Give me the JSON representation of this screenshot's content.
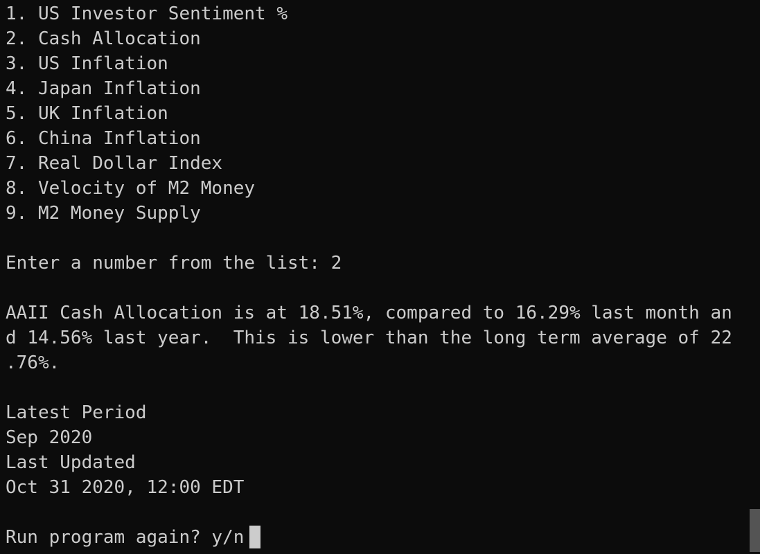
{
  "menu": {
    "items": [
      "1. US Investor Sentiment %",
      "2. Cash Allocation",
      "3. US Inflation",
      "4. Japan Inflation",
      "5. UK Inflation",
      "6. China Inflation",
      "7. Real Dollar Index",
      "8. Velocity of M2 Money",
      "9. M2 Money Supply"
    ]
  },
  "prompt": {
    "enter_number": "Enter a number from the list: 2"
  },
  "result": {
    "lines": [
      "AAII Cash Allocation is at 18.51%, compared to 16.29% last month an",
      "d 14.56% last year.  This is lower than the long term average of 22",
      ".76%."
    ]
  },
  "meta": {
    "latest_period_label": "Latest Period",
    "latest_period_value": "Sep 2020",
    "last_updated_label": "Last Updated",
    "last_updated_value": "Oct 31 2020, 12:00 EDT"
  },
  "run_again_prompt": "Run program again? y/n"
}
